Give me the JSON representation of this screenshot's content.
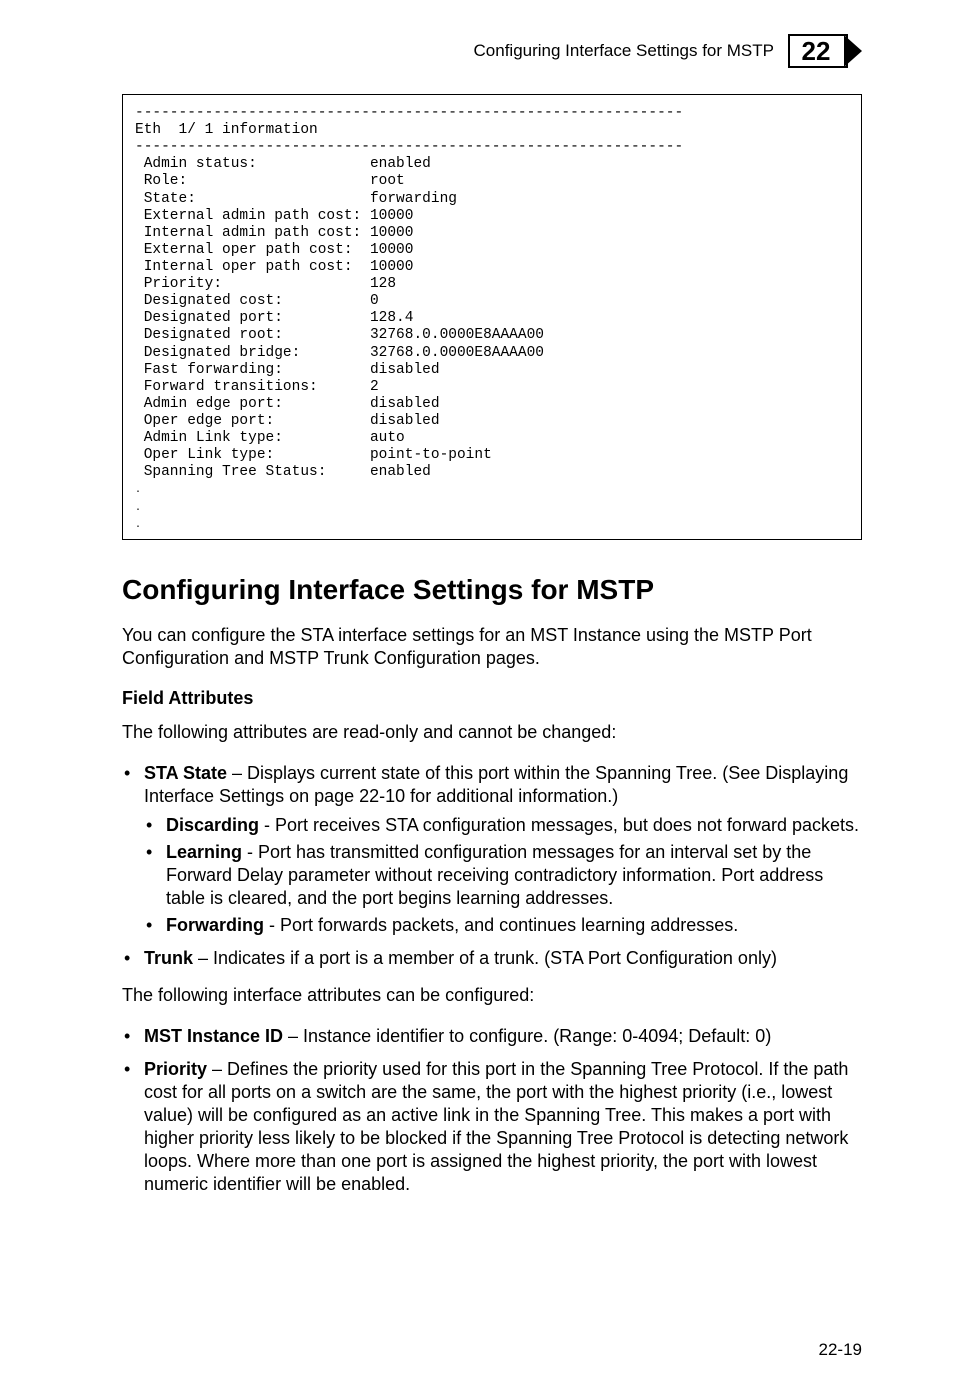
{
  "header": {
    "running_title": "Configuring Interface Settings for MSTP",
    "chapter_number": "22"
  },
  "code_block": {
    "sep": "---------------------------------------------------------------",
    "title": "Eth  1/ 1 information",
    "rows": [
      {
        "label": " Admin status:             ",
        "value": "enabled"
      },
      {
        "label": " Role:                     ",
        "value": "root"
      },
      {
        "label": " State:                    ",
        "value": "forwarding"
      },
      {
        "label": " External admin path cost: ",
        "value": "10000"
      },
      {
        "label": " Internal admin path cost: ",
        "value": "10000"
      },
      {
        "label": " External oper path cost:  ",
        "value": "10000"
      },
      {
        "label": " Internal oper path cost:  ",
        "value": "10000"
      },
      {
        "label": " Priority:                 ",
        "value": "128"
      },
      {
        "label": " Designated cost:          ",
        "value": "0"
      },
      {
        "label": " Designated port:          ",
        "value": "128.4"
      },
      {
        "label": " Designated root:          ",
        "value": "32768.0.0000E8AAAA00"
      },
      {
        "label": " Designated bridge:        ",
        "value": "32768.0.0000E8AAAA00"
      },
      {
        "label": " Fast forwarding:          ",
        "value": "disabled"
      },
      {
        "label": " Forward transitions:      ",
        "value": "2"
      },
      {
        "label": " Admin edge port:          ",
        "value": "disabled"
      },
      {
        "label": " Oper edge port:           ",
        "value": "disabled"
      },
      {
        "label": " Admin Link type:          ",
        "value": "auto"
      },
      {
        "label": " Oper Link type:           ",
        "value": "point-to-point"
      },
      {
        "label": " Spanning Tree Status:     ",
        "value": "enabled"
      }
    ]
  },
  "section": {
    "title": "Configuring Interface Settings for MSTP",
    "intro": "You can configure the STA interface settings for an MST Instance using the MSTP Port Configuration and MSTP Trunk Configuration pages.",
    "field_attributes_heading": "Field Attributes",
    "readonly_intro": "The following attributes are read-only and cannot be changed:",
    "bullets_ro": [
      {
        "term": "STA State",
        "rest": " – Displays current state of this port within the Spanning Tree. (See Displaying Interface Settings on page 22-10 for additional information.)",
        "sub": [
          {
            "term": "Discarding",
            "rest": " - Port receives STA configuration messages, but does not forward packets."
          },
          {
            "term": "Learning",
            "rest": " - Port has transmitted configuration messages for an interval set by the Forward Delay parameter without receiving contradictory information. Port address table is cleared, and the port begins learning addresses."
          },
          {
            "term": "Forwarding",
            "rest": " - Port forwards packets, and continues learning addresses."
          }
        ]
      },
      {
        "term": "Trunk",
        "rest": " – Indicates if a port is a member of a trunk. (STA Port Configuration only)"
      }
    ],
    "config_intro": "The following interface attributes can be configured:",
    "bullets_cfg": [
      {
        "term": "MST Instance ID",
        "rest": " – Instance identifier to configure. (Range: 0-4094; Default: 0)"
      },
      {
        "term": "Priority",
        "rest": " – Defines the priority used for this port in the Spanning Tree Protocol. If the path cost for all ports on a switch are the same, the port with the highest priority (i.e., lowest value) will be configured as an active link in the Spanning Tree. This makes a port with higher priority less likely to be blocked if the Spanning Tree Protocol is detecting network loops. Where more than one port is assigned the highest priority, the port with lowest numeric identifier will be enabled."
      }
    ]
  },
  "footer": {
    "page_num": "22-19"
  }
}
